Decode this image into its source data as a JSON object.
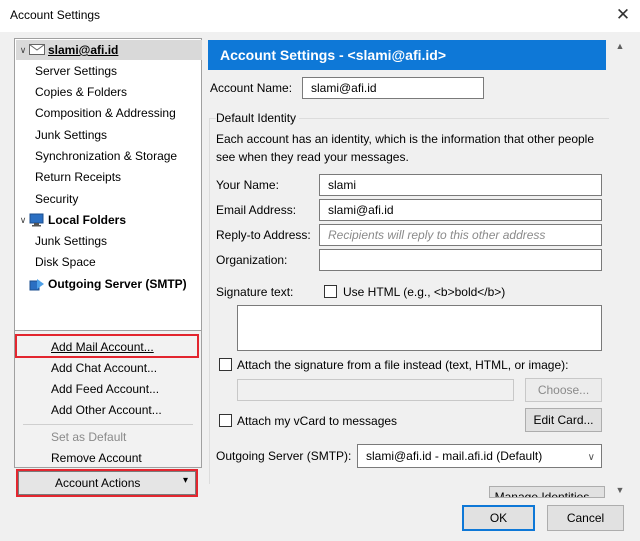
{
  "window": {
    "title": "Account Settings",
    "close_icon": "close-icon"
  },
  "tree": {
    "account": "slami@afi.id",
    "items": [
      "Server Settings",
      "Copies & Folders",
      "Composition & Addressing",
      "Junk Settings",
      "Synchronization & Storage",
      "Return Receipts",
      "Security"
    ],
    "local_folders": "Local Folders",
    "local_items": [
      "Junk Settings",
      "Disk Space"
    ],
    "outgoing": "Outgoing Server (SMTP)"
  },
  "menu": {
    "add_mail": "Add Mail Account...",
    "add_chat": "Add Chat Account...",
    "add_feed": "Add Feed Account...",
    "add_other": "Add Other Account...",
    "set_default": "Set as Default",
    "remove": "Remove Account"
  },
  "account_actions": {
    "label": "Account Actions",
    "arrow": "▾"
  },
  "panel": {
    "banner": "Account Settings - <slami@afi.id>",
    "account_name_label": "Account Name:",
    "account_name_value": "slami@afi.id",
    "default_identity": "Default Identity",
    "description": "Each account has an identity, which is the information that other people see when they read your messages.",
    "your_name_label": "Your Name:",
    "your_name_value": "slami",
    "email_label": "Email Address:",
    "email_value": "slami@afi.id",
    "reply_to_label": "Reply-to Address:",
    "reply_to_placeholder": "Recipients will reply to this other address",
    "organization_label": "Organization:",
    "organization_value": "",
    "signature_label": "Signature text:",
    "use_html_label": "Use HTML (e.g., <b>bold</b>)",
    "attach_sig_label": "Attach the signature from a file instead (text, HTML, or image):",
    "choose_button": "Choose...",
    "attach_vcard_label": "Attach my vCard to messages",
    "edit_card_button": "Edit Card...",
    "outgoing_label": "Outgoing Server (SMTP):",
    "outgoing_value": "slami@afi.id - mail.afi.id (Default)",
    "manage_identities": "Manage Identities..."
  },
  "buttons": {
    "ok": "OK",
    "cancel": "Cancel"
  },
  "colors": {
    "accent": "#0e78d7",
    "highlight_box": "#e3262f"
  }
}
